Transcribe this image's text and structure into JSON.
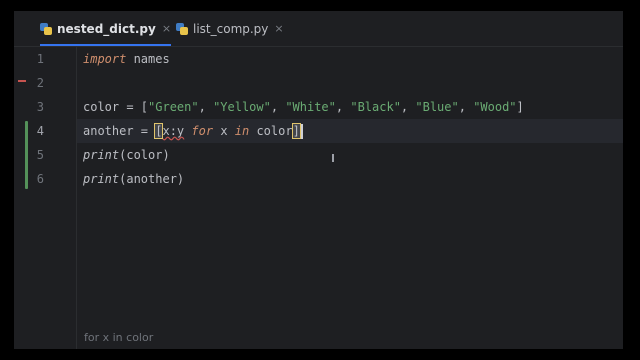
{
  "tabs": [
    {
      "label": "nested_dict.py",
      "active": true,
      "close": "×"
    },
    {
      "label": "list_comp.py",
      "active": false,
      "close": "×"
    }
  ],
  "gutter": {
    "line_numbers": [
      "1",
      "2",
      "3",
      "4",
      "5",
      "6"
    ],
    "current_line": "4"
  },
  "code": {
    "line1": {
      "kw": "import",
      "rest": " names"
    },
    "line3": {
      "prefix": "color = [",
      "items": [
        "\"Green\"",
        "\"Yellow\"",
        "\"White\"",
        "\"Black\"",
        "\"Blue\"",
        "\"Wood\""
      ],
      "sep": ", ",
      "suffix": "]"
    },
    "line4": {
      "prefix": "another = ",
      "open": "[",
      "expr": "x:y",
      "kw_for": "for",
      "var": " x ",
      "kw_in": "in",
      "target": " color",
      "close": "]"
    },
    "line5": {
      "fn": "print",
      "args": "(color)"
    },
    "line6": {
      "fn": "print",
      "args": "(another)"
    }
  },
  "breadcrumb": "for x in color",
  "colors": {
    "keyword": "#cf8e6d",
    "string": "#6aab73",
    "change_marker": "#549159",
    "tab_underline": "#3574f0"
  }
}
